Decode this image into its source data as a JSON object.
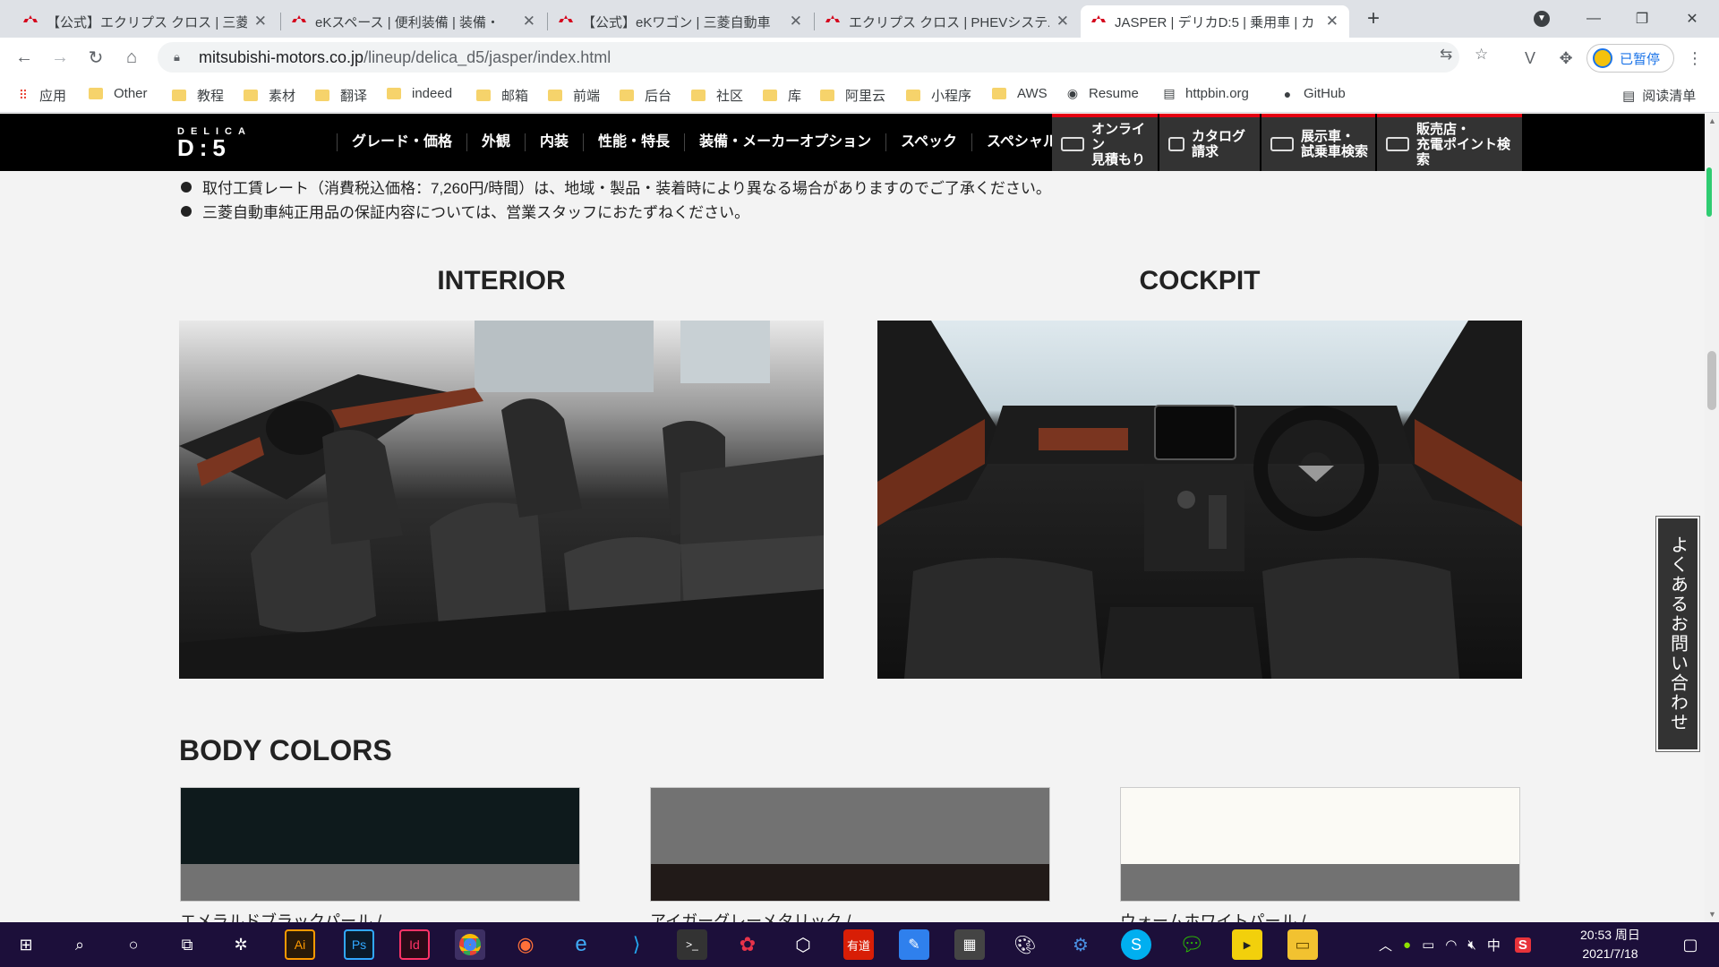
{
  "browser": {
    "tabs": [
      {
        "title": "【公式】エクリプス クロス | 三菱",
        "active": false
      },
      {
        "title": "eKスペース | 便利装備 | 装備・",
        "active": false
      },
      {
        "title": "【公式】eKワゴン | 三菱自動車",
        "active": false
      },
      {
        "title": "エクリプス クロス | PHEVシステム",
        "active": false
      },
      {
        "title": "JASPER | デリカD:5 | 乗用車 | カ",
        "active": true
      }
    ],
    "url_host": "mitsubishi-motors.co.jp",
    "url_path": "/lineup/delica_d5/jasper/index.html",
    "profile_label": "已暂停",
    "bookmarks": [
      "应用",
      "Other",
      "教程",
      "素材",
      "翻译",
      "indeed",
      "邮箱",
      "前端",
      "后台",
      "社区",
      "库",
      "阿里云",
      "小程序",
      "AWS",
      "Resume",
      "httpbin.org",
      "GitHub"
    ],
    "reading_list": "阅读清单"
  },
  "site": {
    "logo_top": "DELICA",
    "logo_bottom": "D:5",
    "nav": [
      "グレード・価格",
      "外観",
      "内装",
      "性能・特長",
      "装備・メーカーオプション",
      "スペック",
      "スペシャル"
    ],
    "quick_links": [
      {
        "line1": "オンライン",
        "line2": "見積もり"
      },
      {
        "line1": "カタログ",
        "line2": "請求"
      },
      {
        "line1": "展示車・",
        "line2": "試乗車検索"
      },
      {
        "line1": "販売店・",
        "line2": "充電ポイント検索"
      }
    ]
  },
  "notes": [
    "取付工賃レート（消費税込価格：7,260円/時間）は、地域・製品・装着時により異なる場合がありますのでご了承ください。",
    "三菱自動車純正用品の保証内容については、営業スタッフにおたずねください。"
  ],
  "sections": {
    "interior": "INTERIOR",
    "cockpit": "COCKPIT",
    "body_colors": "BODY COLORS"
  },
  "colors": [
    {
      "label": "エメラルドブラックパール /",
      "upper": "#0e1a1c",
      "lower": "#727272"
    },
    {
      "label": "アイガーグレーメタリック /",
      "upper": "#727272",
      "lower": "#211a18"
    },
    {
      "label": "ウォームホワイトパール /",
      "upper": "#fbfaf5",
      "lower": "#727272"
    }
  ],
  "faq": "よくあるお問い合わせ",
  "taskbar": {
    "time": "20:53 周日",
    "date": "2021/7/18",
    "ime": "中"
  }
}
